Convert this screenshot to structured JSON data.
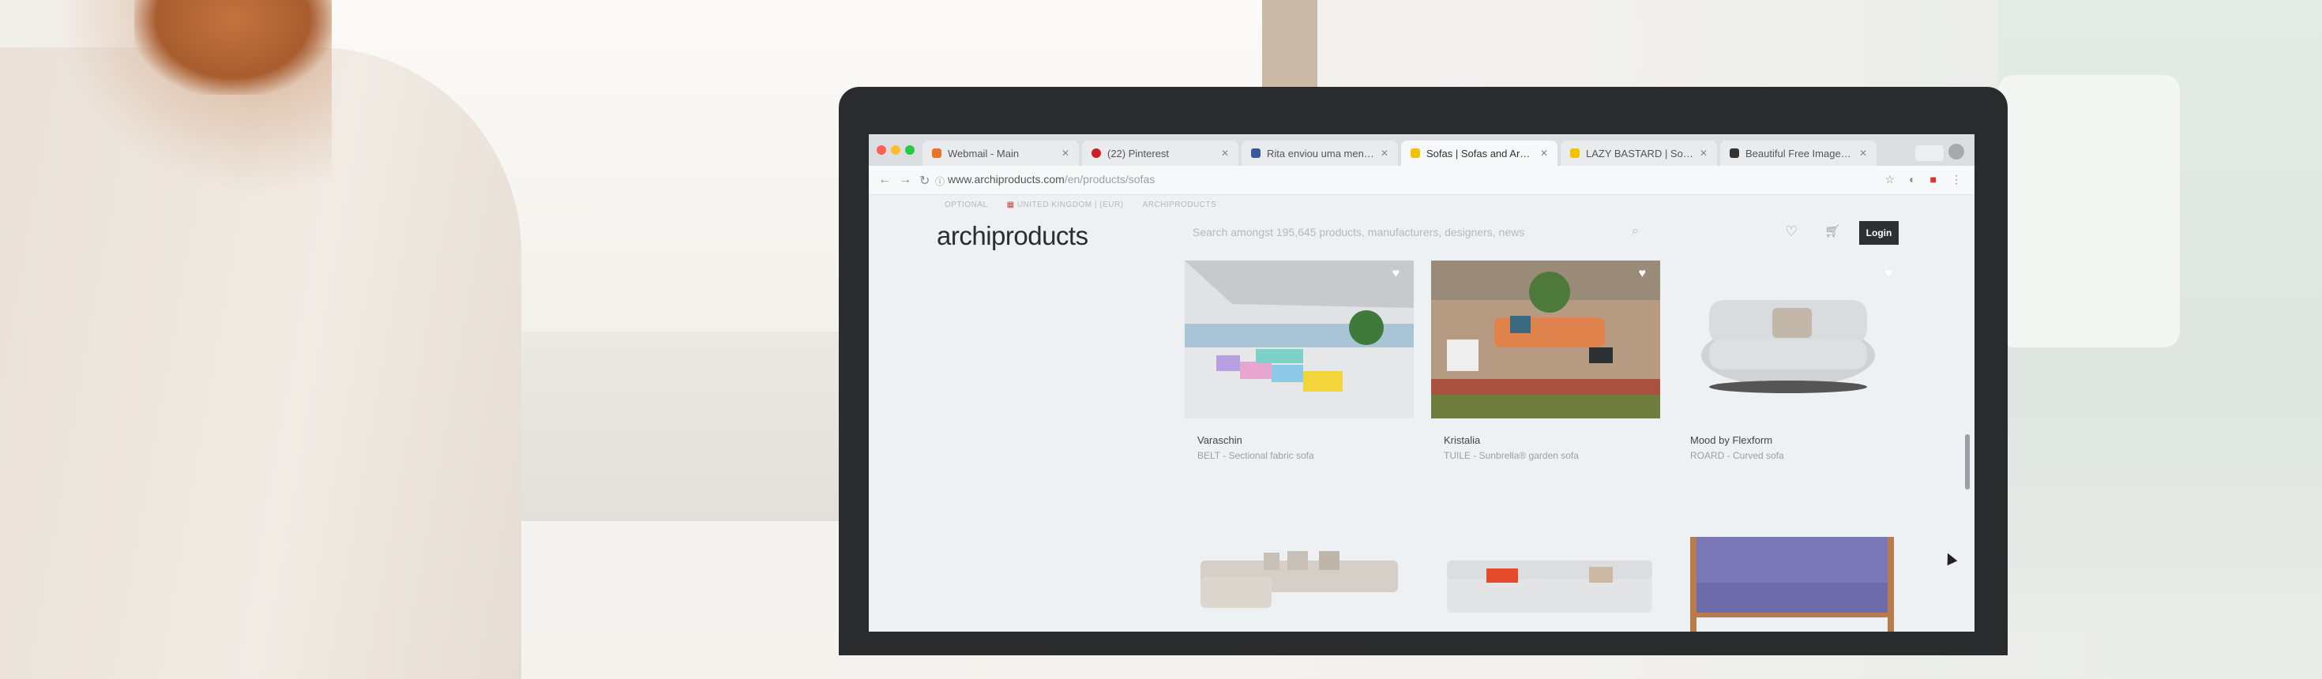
{
  "browser": {
    "tabs": [
      {
        "title": "Webmail - Main",
        "color": "#e8742a",
        "active": false
      },
      {
        "title": "(22) Pinterest",
        "color": "#cb2027",
        "active": false
      },
      {
        "title": "Rita enviou uma mensagem",
        "color": "#3b5998",
        "active": false
      },
      {
        "title": "Sofas | Sofas and Armchairs",
        "color": "#f2c200",
        "active": true
      },
      {
        "title": "LAZY BASTARD | Sofa Co...",
        "color": "#f2c200",
        "active": false
      },
      {
        "title": "Beautiful Free Images | Uns...",
        "color": "#333333",
        "active": false
      }
    ],
    "url_host": "www.archiproducts.com",
    "url_path": "/en/products/sofas"
  },
  "site": {
    "subbar": [
      "OPTIONAL",
      "UNITED KINGDOM | (EUR)",
      "ARCHIPRODUCTS"
    ],
    "logo": "archiproducts",
    "search_placeholder": "Search amongst 195,645 products, manufacturers, designers, news",
    "login_label": "Login"
  },
  "products": [
    {
      "name": "Varaschin",
      "desc": "BELT - Sectional fabric sofa"
    },
    {
      "name": "Kristalia",
      "desc": "TUILE - Sunbrella® garden sofa"
    },
    {
      "name": "Mood by Flexform",
      "desc": "ROARD - Curved sofa"
    }
  ],
  "colors": {
    "laptop_bezel": "#2a2b2d",
    "screen_bg": "#eef1f3",
    "login_bg": "#2c2f33",
    "hair": "#b0652f"
  }
}
